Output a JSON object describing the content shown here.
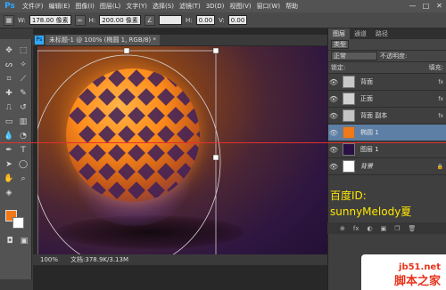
{
  "app": {
    "logo": "Ps"
  },
  "menubar": {
    "items": [
      "文件(F)",
      "编辑(E)",
      "图像(I)",
      "图层(L)",
      "文字(Y)",
      "选择(S)",
      "滤镜(T)",
      "3D(D)",
      "视图(V)",
      "窗口(W)",
      "帮助"
    ],
    "win_controls": [
      "—",
      "□",
      "✕"
    ]
  },
  "optionsbar": {
    "w_label": "W:",
    "w_value": "178.00 像素",
    "h_label": "H:",
    "h_value": "200.00 像素",
    "x_label": "H:",
    "x_value": "0.00",
    "y_label": "V:",
    "y_value": "0.00"
  },
  "document": {
    "tab_label": "未标题-1 @ 100% (椭圆 1, RGB/8) *",
    "status_zoom": "100%",
    "status_doc": "文档:378.9K/3.13M"
  },
  "panels": {
    "tabs": [
      "图层",
      "通道",
      "路径"
    ],
    "filter_label": "类型",
    "blend_mode": "正常",
    "opacity_label": "不透明度:",
    "opacity_value": "",
    "lock_label": "锁定:",
    "fill_label": "填充:",
    "layers": [
      {
        "name": "背面",
        "fx": "fx"
      },
      {
        "name": "正面",
        "fx": "fx"
      },
      {
        "name": "背面 副本",
        "fx": "fx"
      },
      {
        "name": "椭圆 1",
        "fx": ""
      },
      {
        "name": "图层 1",
        "fx": ""
      },
      {
        "name": "背景",
        "fx": ""
      }
    ],
    "bottom_icons": [
      "⊕",
      "fx",
      "◐",
      "▣",
      "❐",
      "🗑"
    ]
  },
  "overlay": {
    "id_line": "百度ID:",
    "name_line": "sunnyMelody夏"
  },
  "watermark": {
    "url": "jb51.net",
    "text": "脚本之家"
  },
  "colors": {
    "foreground": "#f07818",
    "background": "#ffffff",
    "guide": "#e23030"
  }
}
